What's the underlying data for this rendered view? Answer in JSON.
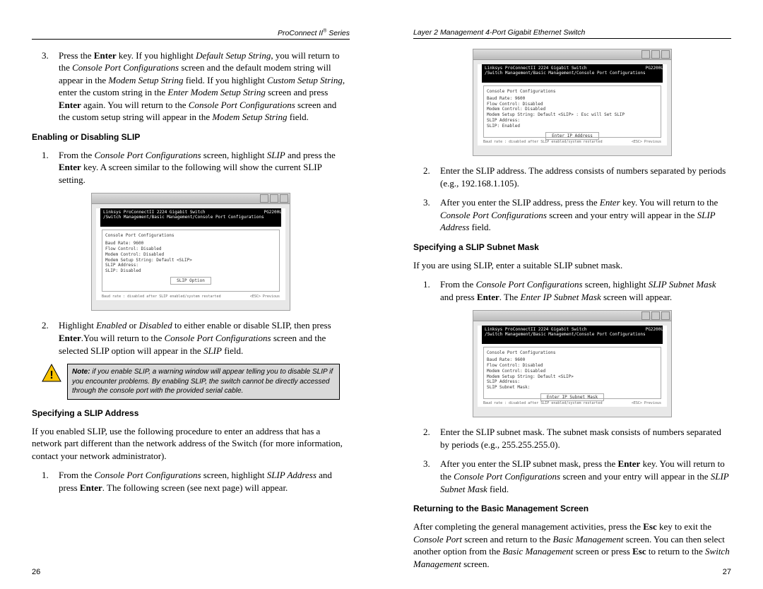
{
  "left": {
    "header": "ProConnect II® Series",
    "page_num": "26",
    "step3": "Press the Enter key. If you highlight Default Setup String, you will return to the Console Port Configurations screen and the default modem string will appear in the Modem Setup String field. If you highlight Custom Setup String, enter the custom string in the Enter Modem Setup String screen and press Enter again. You will return to the Console Port Configurations screen and the custom setup string will appear in the Modem Setup String field.",
    "h_enable": "Enabling or Disabling SLIP",
    "en_step1": "From the Console Port Configurations screen, highlight SLIP and press the Enter key. A screen similar to the following will show the current SLIP setting.",
    "en_step2": "Highlight Enabled or Disabled to either enable or disable SLIP, then press Enter.You will return to the Console Port Configurations screen and the selected SLIP option will appear in the SLIP field.",
    "note": "Note: if you enable SLIP, a warning window will appear telling you to disable SLIP if you encounter problems. By enabling SLIP, the switch cannot be directly accessed through the console port with the provided serial cable.",
    "h_addr": "Specifying a SLIP Address",
    "addr_intro": "If you enabled SLIP, use the following procedure to enter an address that has a network part different than the network address of the Switch (for more information, contact your network administrator).",
    "addr_step1": "From the Console Port Configurations screen, highlight SLIP Address and press Enter. The following screen (see next page) will appear."
  },
  "right": {
    "header": "Layer 2 Management 4-Port Gigabit Ethernet Switch",
    "page_num": "27",
    "addr_step2": "Enter the SLIP address. The address consists of numbers separated by periods (e.g., 192.168.1.105).",
    "addr_step3": "After you enter the SLIP address, press the Enter key. You will return to the Console Port Configurations screen and your entry will appear in the SLIP Address field.",
    "h_mask": "Specifying a SLIP Subnet Mask",
    "mask_intro": "If you are using SLIP, enter a suitable SLIP subnet mask.",
    "mask_step1": "From the Console Port Configurations screen, highlight SLIP Subnet Mask and press Enter. The Enter IP Subnet Mask screen will appear.",
    "mask_step2": "Enter the SLIP subnet mask. The subnet mask consists of numbers separated by periods (e.g., 255.255.255.0).",
    "mask_step3": "After you enter the SLIP subnet mask, press the Enter key. You will return to the Console Port Configurations screen and your entry will appear in the SLIP Subnet Mask field.",
    "h_return": "Returning to the Basic Management Screen",
    "return_p": "After completing the general management activities, press the Esc key to exit the Console Port screen and return to the Basic Management screen. You can then select another option from the Basic Management screen or press Esc to return to the Switch Management screen."
  },
  "screenshot": {
    "banner_left": "Linksys ProConnectII 2224 Gigabit Switch",
    "banner_right": "PG2200L",
    "banner_sub": "/Switch Management/Basic Management/Console Port Configurations",
    "panel_title": "Console Port Configurations",
    "lines_slip": "Baud Rate: 9600\nFlow Control: Disabled\nModem Control: Disabled\nModem Setup String: Default <SLIP>\nSLIP Address:\nSLIP: Disabled",
    "lines_addr": "Baud Rate: 9600\nFlow Control: Disabled\nModem Control: Disabled\nModem Setup String: Default <SLIP> : Esc will Set SLIP\nSLIP Address:\nSLIP: Enabled",
    "lines_mask": "Baud Rate: 9600\nFlow Control: Disabled\nModem Control: Disabled\nModem Setup String: Default <SLIP>\nSLIP Address:\nSLIP Subnet Mask:",
    "box_slip": "SLIP Option",
    "box_addr": "Enter IP Address",
    "box_mask": "Enter IP Subnet Mask",
    "status_l": "Baud rate : disabled after SLIP enabled/system restarted",
    "status_r": "<ESC> Previous"
  }
}
